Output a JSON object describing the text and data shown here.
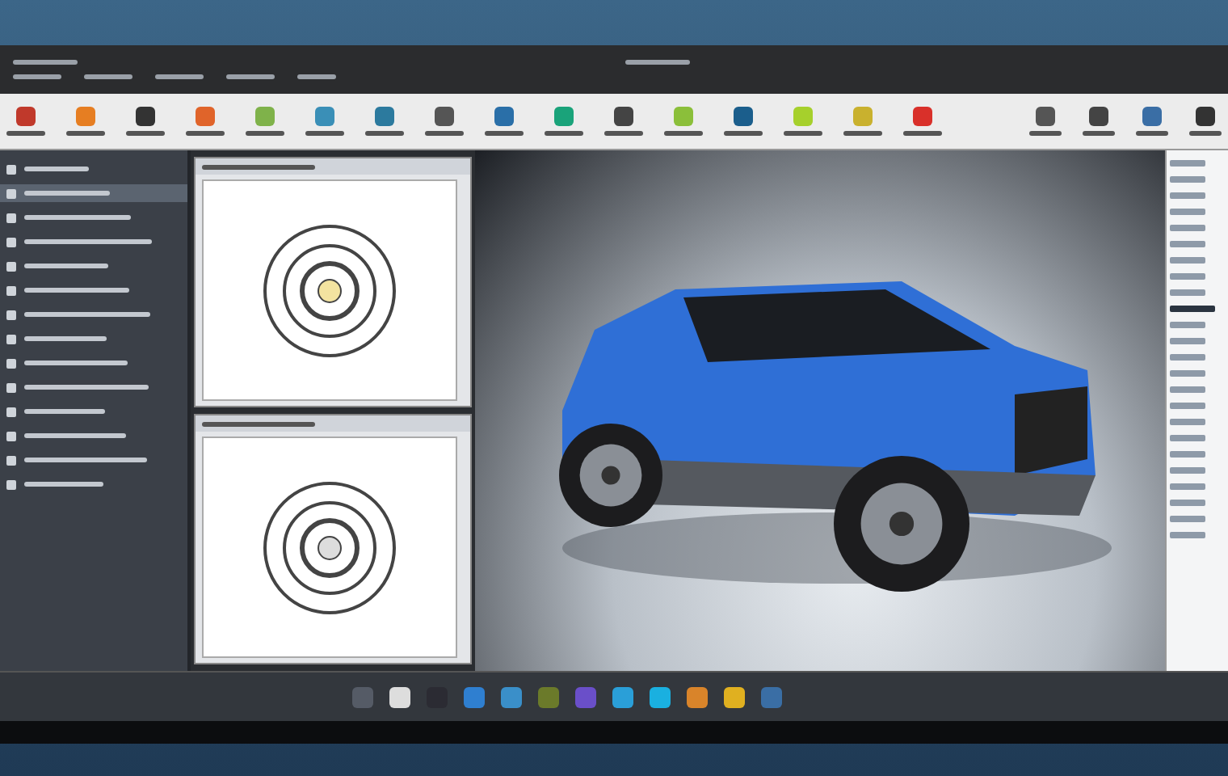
{
  "ribbon": {
    "tools": [
      {
        "color": "#c0392b"
      },
      {
        "color": "#e67e22"
      },
      {
        "color": "#333333"
      },
      {
        "color": "#e0642a"
      },
      {
        "color": "#7fb24a"
      },
      {
        "color": "#3a8fb7"
      },
      {
        "color": "#2c7a9e"
      },
      {
        "color": "#555555"
      },
      {
        "color": "#2a6fa8"
      },
      {
        "color": "#1aa37a"
      },
      {
        "color": "#444444"
      },
      {
        "color": "#8bbf3a"
      },
      {
        "color": "#1b5e8c"
      },
      {
        "color": "#a6d02c"
      },
      {
        "color": "#c9b12e"
      },
      {
        "color": "#d9302a"
      }
    ],
    "right_tools": [
      {
        "color": "#555555"
      },
      {
        "color": "#444444"
      },
      {
        "color": "#3a6ea5"
      },
      {
        "color": "#333333"
      }
    ]
  },
  "sidebar": {
    "items": [
      {
        "selected": false
      },
      {
        "selected": true
      },
      {
        "selected": false
      },
      {
        "selected": false
      },
      {
        "selected": false
      },
      {
        "selected": false
      },
      {
        "selected": false
      },
      {
        "selected": false
      },
      {
        "selected": false
      },
      {
        "selected": false
      },
      {
        "selected": false
      },
      {
        "selected": false
      },
      {
        "selected": false
      },
      {
        "selected": false
      }
    ]
  },
  "properties": {
    "rows": [
      {
        "selected": false
      },
      {
        "selected": false
      },
      {
        "selected": false
      },
      {
        "selected": false
      },
      {
        "selected": false
      },
      {
        "selected": false
      },
      {
        "selected": false
      },
      {
        "selected": false
      },
      {
        "selected": false
      },
      {
        "selected": true
      },
      {
        "selected": false
      },
      {
        "selected": false
      },
      {
        "selected": false
      },
      {
        "selected": false
      },
      {
        "selected": false
      },
      {
        "selected": false
      },
      {
        "selected": false
      },
      {
        "selected": false
      },
      {
        "selected": false
      },
      {
        "selected": false
      },
      {
        "selected": false
      },
      {
        "selected": false
      },
      {
        "selected": false
      },
      {
        "selected": false
      }
    ]
  },
  "taskbar": {
    "apps": [
      {
        "color": "#555b66"
      },
      {
        "color": "#dddddd"
      },
      {
        "color": "#2b2b33"
      },
      {
        "color": "#2f7fd0"
      },
      {
        "color": "#3a8fc9"
      },
      {
        "color": "#6b7a2a"
      },
      {
        "color": "#6a4fc9"
      },
      {
        "color": "#2a9fd8"
      },
      {
        "color": "#1ab0e0"
      },
      {
        "color": "#d9842a"
      },
      {
        "color": "#e0b020"
      },
      {
        "color": "#3a6ea5"
      }
    ]
  }
}
